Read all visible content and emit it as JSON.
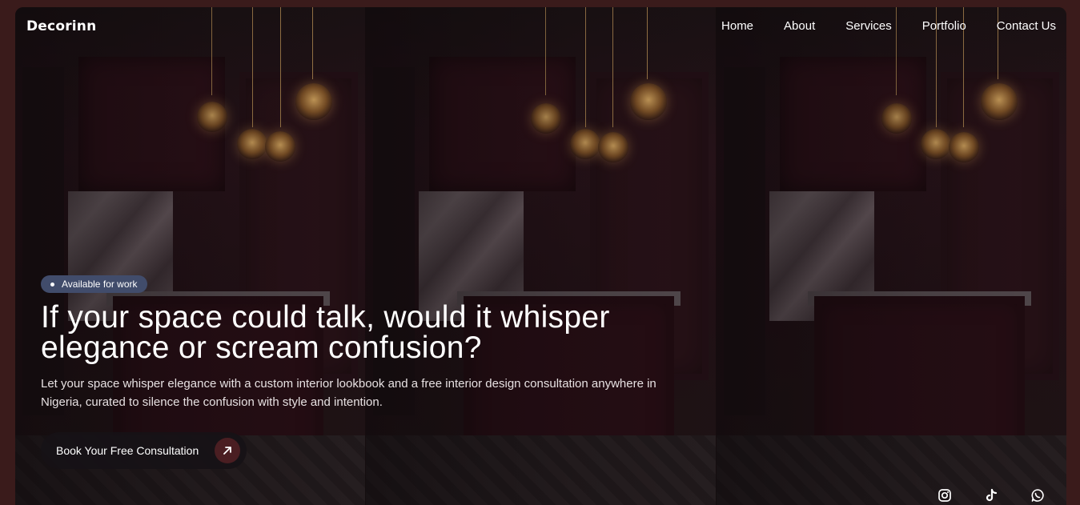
{
  "brand": {
    "logo": "Decorinn"
  },
  "nav": {
    "items": [
      {
        "label": "Home"
      },
      {
        "label": "About"
      },
      {
        "label": "Services"
      },
      {
        "label": "Portfolio"
      },
      {
        "label": "Contact Us"
      }
    ]
  },
  "hero": {
    "badge": "Available for work",
    "headline_line1": "If your space could talk, would it whisper",
    "headline_line2": "elegance or scream confusion?",
    "subtext": "Let your space whisper elegance with a custom interior lookbook and a free interior design consultation anywhere in Nigeria, curated to silence the confusion with style and intention.",
    "cta_label": "Book Your Free Consultation",
    "cta_icon": "arrow-up-right-icon"
  },
  "social": {
    "icons": [
      "instagram-icon",
      "tiktok-icon",
      "whatsapp-icon"
    ]
  },
  "colors": {
    "page_bg": "#3a1b1b",
    "badge_bg": "#414c6b",
    "cta_bg": "#161216",
    "cta_icon_bg": "#4a1e22",
    "text": "#ffffff"
  }
}
